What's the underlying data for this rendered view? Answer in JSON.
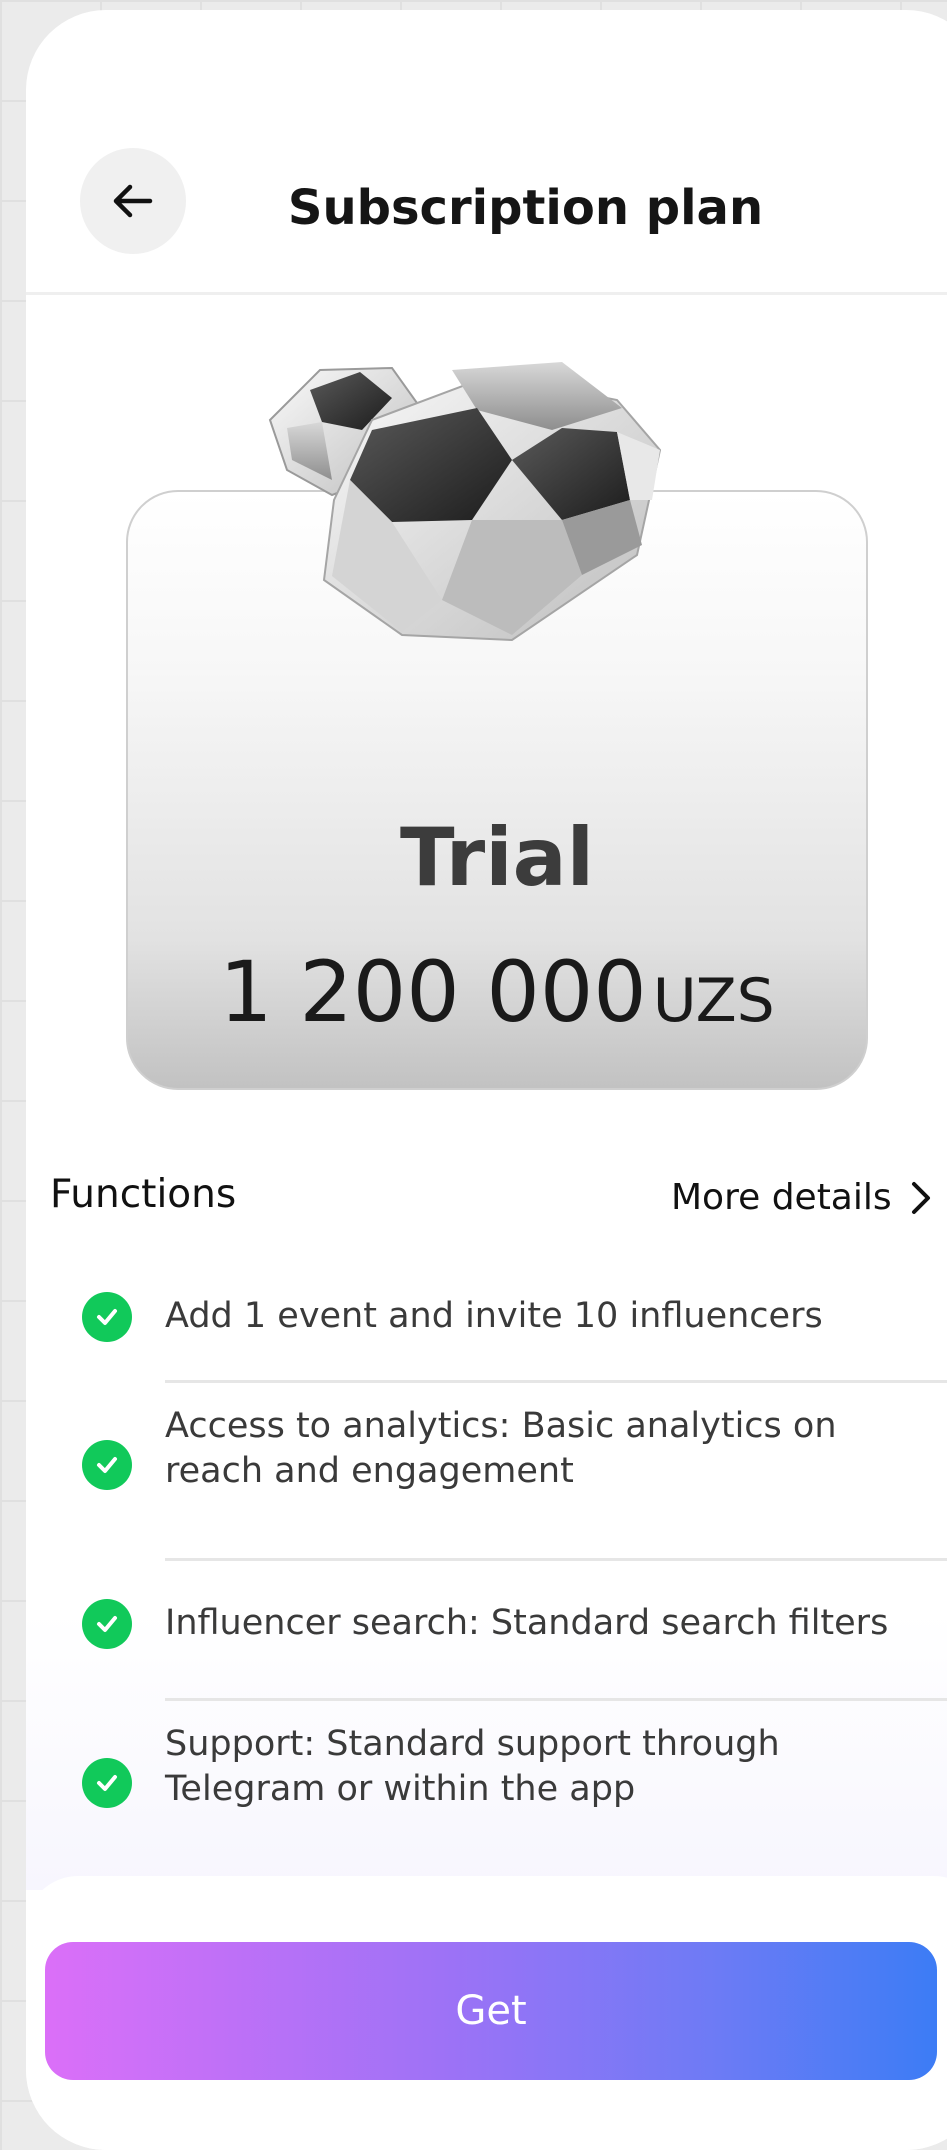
{
  "header": {
    "title": "Subscription plan",
    "back_icon": "arrow-left-icon"
  },
  "plan": {
    "image_icon": "diamond-gem-icon",
    "name": "Trial",
    "price_amount": "1 200 000",
    "price_currency": "UZS"
  },
  "functions": {
    "title": "Functions",
    "more_details_label": "More details",
    "more_details_icon": "chevron-right-icon",
    "items": [
      {
        "text": "Add 1 event and invite 10 influencers",
        "icon": "check-circle-icon"
      },
      {
        "text": "Access to analytics: Basic analytics on reach and engagement",
        "icon": "check-circle-icon"
      },
      {
        "text": "Influencer search: Standard search filters",
        "icon": "check-circle-icon"
      },
      {
        "text": "Support: Standard support through Telegram or within the app",
        "icon": "check-circle-icon"
      }
    ]
  },
  "action": {
    "get_label": "Get"
  },
  "colors": {
    "check": "#11c95a",
    "gradient_start": "#db6ff8",
    "gradient_end": "#3c7cf5",
    "title_text": "#151515"
  }
}
